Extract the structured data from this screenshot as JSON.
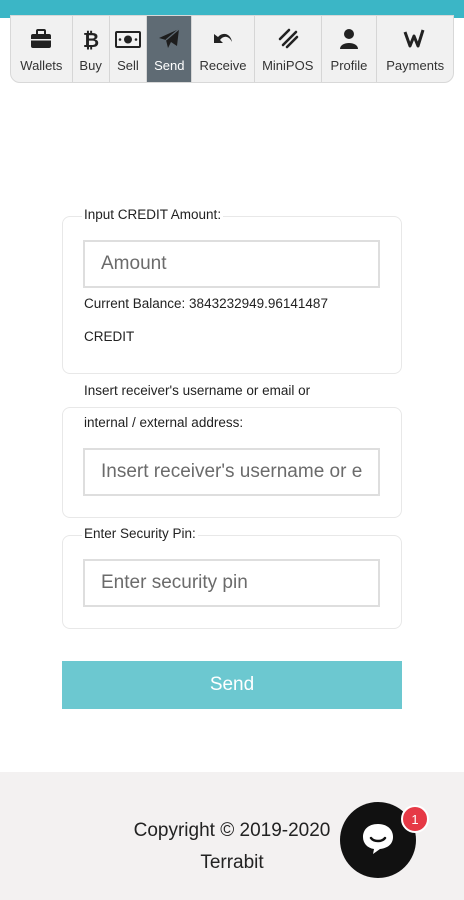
{
  "nav": {
    "tabs": [
      {
        "label": "Wallets",
        "icon": "briefcase-icon"
      },
      {
        "label": "Buy",
        "icon": "bitcoin-icon"
      },
      {
        "label": "Sell",
        "icon": "money-icon"
      },
      {
        "label": "Send",
        "icon": "paper-plane-icon",
        "active": true
      },
      {
        "label": "Receive",
        "icon": "receive-arrow-icon"
      },
      {
        "label": "MiniPOS",
        "icon": "pos-icon"
      },
      {
        "label": "Profile",
        "icon": "user-icon"
      },
      {
        "label": "Payments",
        "icon": "payments-icon"
      }
    ]
  },
  "form": {
    "amount": {
      "label": "Input CREDIT Amount:",
      "placeholder": "Amount",
      "balance_line1": "Current Balance: 3843232949.96141487",
      "balance_line2": "CREDIT"
    },
    "receiver": {
      "label_line1": "Insert receiver's username or email or",
      "label_line2": "internal / external address:",
      "placeholder": "Insert receiver's username or email or internal / external address"
    },
    "pin": {
      "label": "Enter Security Pin:",
      "placeholder": "Enter security pin"
    },
    "send_label": "Send"
  },
  "footer": {
    "copyright_line1": "Copyright © 2019-2020",
    "copyright_line2": "Terrabit"
  },
  "chat": {
    "badge_count": "1"
  },
  "colors": {
    "accent": "#3bb6c6",
    "active_tab": "#5f6b74",
    "send_button": "#6cc8d0",
    "badge": "#e63946"
  }
}
